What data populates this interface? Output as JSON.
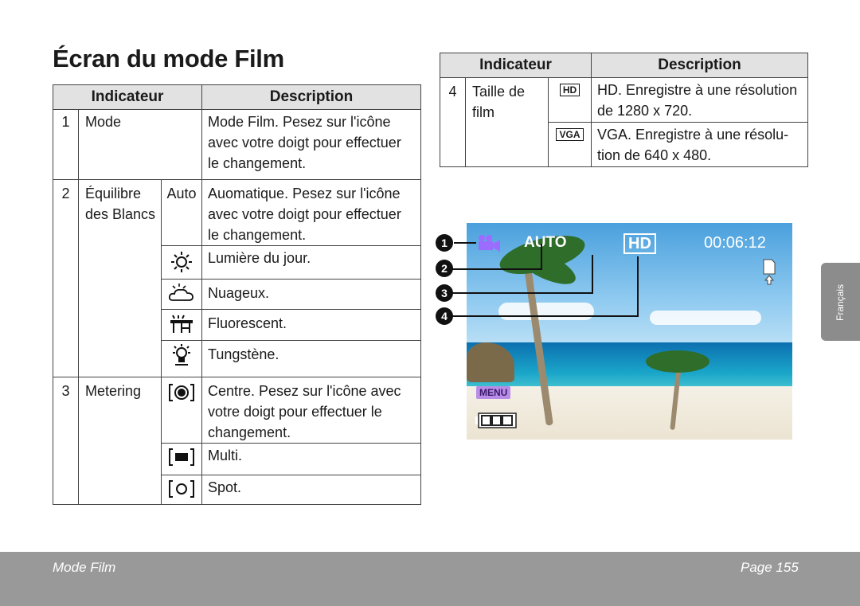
{
  "title": "Écran du mode Film",
  "left_table": {
    "header": {
      "indicator": "Indicateur",
      "description": "Description"
    },
    "rows": [
      {
        "num": "1",
        "name": "Mode",
        "desc": "Mode Film. Pesez sur l'icône avec votre doigt pour effectuer le changement."
      },
      {
        "num": "2",
        "name": "Équilibre des Blancs",
        "auto": "Auto",
        "auto_desc": "Auomatique. Pesez sur l'icône avec votre doigt pour effectuer le changement.",
        "subs": [
          {
            "icon": "sun-icon",
            "desc": "Lumière du jour."
          },
          {
            "icon": "cloudy-icon",
            "desc": "Nuageux."
          },
          {
            "icon": "fluorescent-icon",
            "desc": "Fluorescent."
          },
          {
            "icon": "tungsten-icon",
            "desc": "Tungstène."
          }
        ]
      },
      {
        "num": "3",
        "name": "Metering",
        "subs": [
          {
            "icon": "metering-center-icon",
            "desc": "Centre. Pesez sur l'icône avec votre doigt pour effectuer le changement."
          },
          {
            "icon": "metering-multi-icon",
            "desc": "Multi."
          },
          {
            "icon": "metering-spot-icon",
            "desc": "Spot."
          }
        ]
      }
    ]
  },
  "right_table": {
    "header": {
      "indicator": "Indicateur",
      "description": "Description"
    },
    "row": {
      "num": "4",
      "name": "Taille de film",
      "subs": [
        {
          "icon_text": "HD",
          "desc": "HD. Enregistre à une résolution de 1280 x 720."
        },
        {
          "icon_text": "VGA",
          "desc": "VGA. Enregistre à une résolu- tion de 640 x 480."
        }
      ]
    }
  },
  "screen": {
    "mode_icon": "movie-camera-icon",
    "wb": "AUTO",
    "size": "HD",
    "time": "00:06:12",
    "menu": "MENU",
    "callouts": [
      "1",
      "2",
      "3",
      "4"
    ]
  },
  "side_tab": "Français",
  "footer": {
    "left": "Mode Film",
    "right": "Page 155"
  }
}
